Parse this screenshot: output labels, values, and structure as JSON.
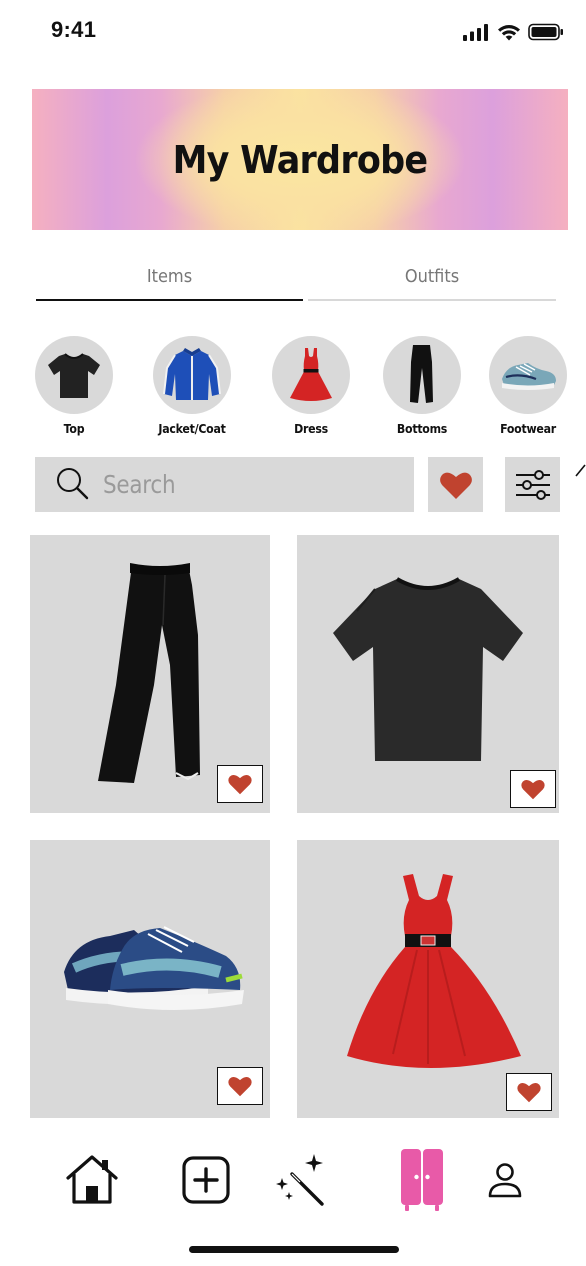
{
  "status_bar": {
    "time": "9:41"
  },
  "header": {
    "title": "My Wardrobe"
  },
  "tabs": [
    {
      "label": "Items",
      "active": true
    },
    {
      "label": "Outfits",
      "active": false
    }
  ],
  "categories": [
    {
      "label": "Top",
      "icon": "t-shirt-icon"
    },
    {
      "label": "Jacket/Coat",
      "icon": "jacket-icon"
    },
    {
      "label": "Dress",
      "icon": "dress-icon"
    },
    {
      "label": "Bottoms",
      "icon": "pants-icon"
    },
    {
      "label": "Footwear",
      "icon": "sneaker-icon"
    }
  ],
  "search": {
    "placeholder": "Search"
  },
  "items": [
    {
      "type": "pants",
      "favorited": true
    },
    {
      "type": "t-shirt",
      "favorited": true
    },
    {
      "type": "sneakers",
      "favorited": true
    },
    {
      "type": "dress",
      "favorited": true
    }
  ],
  "bottom_nav": [
    {
      "icon": "home-icon"
    },
    {
      "icon": "add-icon"
    },
    {
      "icon": "magic-wand-icon"
    },
    {
      "icon": "wardrobe-icon",
      "active": true
    },
    {
      "icon": "profile-icon"
    }
  ],
  "colors": {
    "accent_pink": "#e85aa8",
    "heart_red": "#c0432f",
    "card_gray": "#d9d9d9",
    "text_muted": "#777777"
  }
}
